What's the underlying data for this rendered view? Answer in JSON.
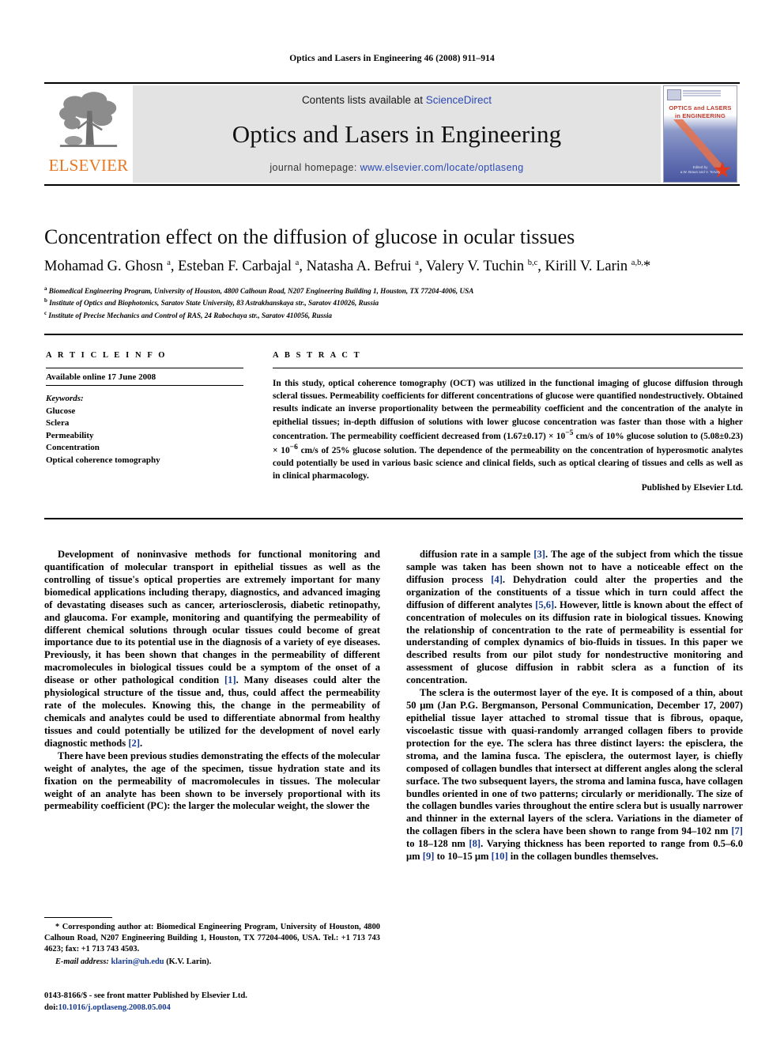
{
  "running_head": "Optics and Lasers in Engineering 46 (2008) 911–914",
  "masthead": {
    "contents_prefix": "Contents lists available at ",
    "sciencedirect": "ScienceDirect",
    "journal_title": "Optics and Lasers in Engineering",
    "homepage_prefix": "journal homepage: ",
    "homepage_url": "www.elsevier.com/locate/optlaseng",
    "publisher_wordmark": "ELSEVIER",
    "cover": {
      "title_line1": "OPTICS and LASERS",
      "title_line2": "in ENGINEERING",
      "footer_line1": "Edited by",
      "footer_line2": "a.W. Braun and V. Tervey"
    },
    "colors": {
      "link": "#2b49b5",
      "elsevier_orange": "#E87722",
      "band_grey": "#e3e3e3",
      "cover_blue": "#4a57a0",
      "cover_red": "#c0392b"
    }
  },
  "article": {
    "title": "Concentration effect on the diffusion of glucose in ocular tissues",
    "authors_html": "Mohamad G. Ghosn <sup>a</sup>, Esteban F. Carbajal <sup>a</sup>, Natasha A. Befrui <sup>a</sup>, Valery V. Tuchin <sup>b,c</sup>, Kirill V. Larin <sup>a,b,</sup>*",
    "affiliations": [
      "Biomedical Engineering Program, University of Houston, 4800 Calhoun Road, N207 Engineering Building 1, Houston, TX 77204-4006, USA",
      "Institute of Optics and Biophotonics, Saratov State University, 83 Astrakhanskaya str., Saratov 410026, Russia",
      "Institute of Precise Mechanics and Control of RAS, 24 Rabochaya str., Saratov 410056, Russia"
    ],
    "affiliation_marks": [
      "a",
      "b",
      "c"
    ]
  },
  "article_info": {
    "heading": "A R T I C L E  I N F O",
    "available_online": "Available online 17 June 2008",
    "keywords_label": "Keywords:",
    "keywords": [
      "Glucose",
      "Sclera",
      "Permeability",
      "Concentration",
      "Optical coherence tomography"
    ]
  },
  "abstract": {
    "heading": "A B S T R A C T",
    "text": "In this study, optical coherence tomography (OCT) was utilized in the functional imaging of glucose diffusion through scleral tissues. Permeability coefficients for different concentrations of glucose were quantified nondestructively. Obtained results indicate an inverse proportionality between the permeability coefficient and the concentration of the analyte in epithelial tissues; in-depth diffusion of solutions with lower glucose concentration was faster than those with a higher concentration. The permeability coefficient decreased from (1.67±0.17) × 10−5 cm/s of 10% glucose solution to (5.08±0.23) × 10−6 cm/s of 25% glucose solution. The dependence of the permeability on the concentration of hyperosmotic analytes could potentially be used in various basic science and clinical fields, such as optical clearing of tissues and cells as well as in clinical pharmacology.",
    "signature": "Published by Elsevier Ltd."
  },
  "body": {
    "left_paragraphs": [
      "Development of noninvasive methods for functional monitoring and quantification of molecular transport in epithelial tissues as well as the controlling of tissue's optical properties are extremely important for many biomedical applications including therapy, diagnostics, and advanced imaging of devastating diseases such as cancer, arteriosclerosis, diabetic retinopathy, and glaucoma. For example, monitoring and quantifying the permeability of different chemical solutions through ocular tissues could become of great importance due to its potential use in the diagnosis of a variety of eye diseases. Previously, it has been shown that changes in the permeability of different macromolecules in biological tissues could be a symptom of the onset of a disease or other pathological condition [1]. Many diseases could alter the physiological structure of the tissue and, thus, could affect the permeability rate of the molecules. Knowing this, the change in the permeability of chemicals and analytes could be used to differentiate abnormal from healthy tissues and could potentially be utilized for the development of novel early diagnostic methods [2].",
      "There have been previous studies demonstrating the effects of the molecular weight of analytes, the age of the specimen, tissue hydration state and its fixation on the permeability of macromolecules in tissues. The molecular weight of an analyte has been shown to be inversely proportional with its permeability coefficient (PC): the larger the molecular weight, the slower the"
    ],
    "right_paragraphs": [
      "diffusion rate in a sample [3]. The age of the subject from which the tissue sample was taken has been shown not to have a noticeable effect on the diffusion process [4]. Dehydration could alter the properties and the organization of the constituents of a tissue which in turn could affect the diffusion of different analytes [5,6]. However, little is known about the effect of concentration of molecules on its diffusion rate in biological tissues. Knowing the relationship of concentration to the rate of permeability is essential for understanding of complex dynamics of bio-fluids in tissues. In this paper we described results from our pilot study for nondestructive monitoring and assessment of glucose diffusion in rabbit sclera as a function of its concentration.",
      "The sclera is the outermost layer of the eye. It is composed of a thin, about 50 μm (Jan P.G. Bergmanson, Personal Communication, December 17, 2007) epithelial tissue layer attached to stromal tissue that is fibrous, opaque, viscoelastic tissue with quasi-randomly arranged collagen fibers to provide protection for the eye. The sclera has three distinct layers: the episclera, the stroma, and the lamina fusca. The episclera, the outermost layer, is chiefly composed of collagen bundles that intersect at different angles along the scleral surface. The two subsequent layers, the stroma and lamina fusca, have collagen bundles oriented in one of two patterns; circularly or meridionally. The size of the collagen bundles varies throughout the entire sclera but is usually narrower and thinner in the external layers of the sclera. Variations in the diameter of the collagen fibers in the sclera have been shown to range from 94–102 nm [7] to 18–128 nm [8]. Varying thickness has been reported to range from 0.5–6.0 μm [9] to 10–15 μm [10] in the collagen bundles themselves."
    ]
  },
  "footnote": {
    "corresponding": "* Corresponding author at: Biomedical Engineering Program, University of Houston, 4800 Calhoun Road, N207 Engineering Building 1, Houston, TX 77204-4006, USA. Tel.: +1 713 743 4623; fax: +1 713 743 4503.",
    "email_label": "E-mail address:",
    "email": "klarin@uh.edu",
    "email_owner": "(K.V. Larin).",
    "copyright": "0143-8166/$ - see front matter Published by Elsevier Ltd.",
    "doi_label": "doi:",
    "doi": "10.1016/j.optlaseng.2008.05.004"
  }
}
